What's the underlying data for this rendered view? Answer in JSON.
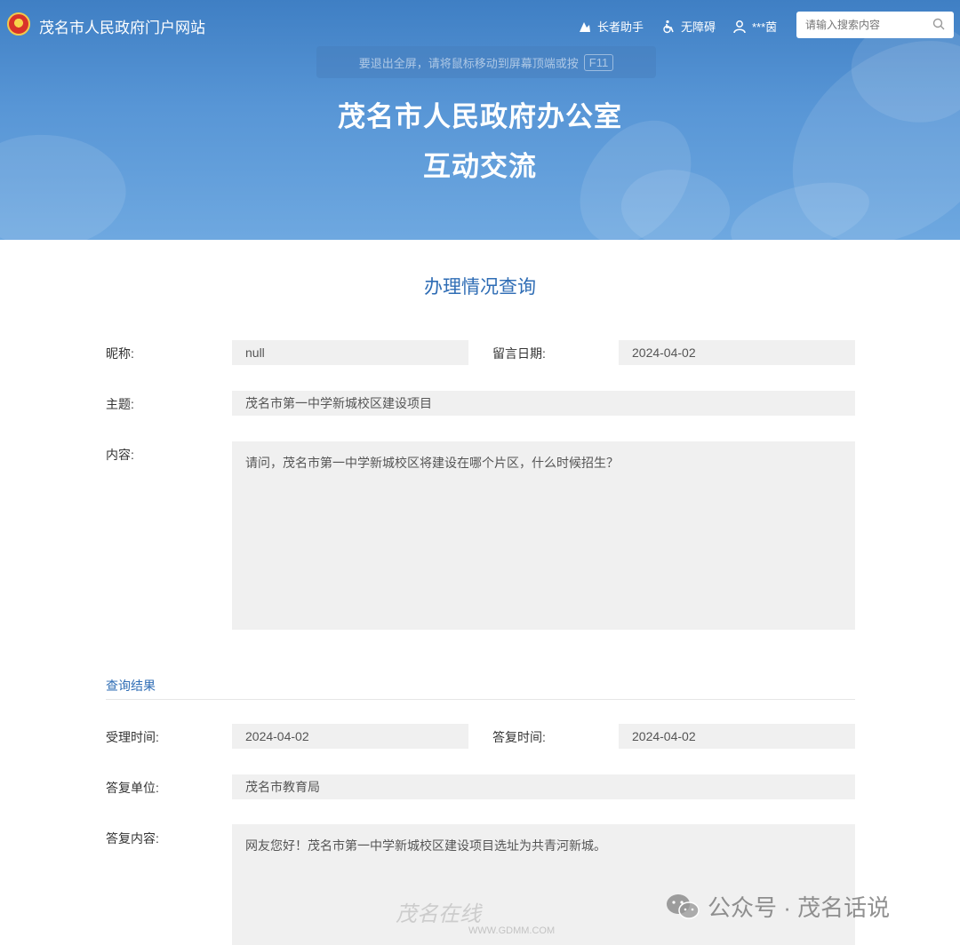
{
  "header": {
    "site_name": "茂名市人民政府门户网站",
    "tools": {
      "elder": "长者助手",
      "accessible": "无障碍",
      "user": "***茵"
    },
    "search_placeholder": "请输入搜索内容"
  },
  "fullscreen_hint": {
    "text": "要退出全屏，请将鼠标移动到屏幕顶端或按",
    "key": "F11"
  },
  "banner": {
    "title_line1": "茂名市人民政府办公室",
    "title_line2": "互动交流"
  },
  "page_title": "办理情况查询",
  "message": {
    "nickname_label": "昵称:",
    "nickname": "null",
    "date_label": "留言日期:",
    "date": "2024-04-02",
    "subject_label": "主题:",
    "subject": "茂名市第一中学新城校区建设项目",
    "content_label": "内容:",
    "content": "请问，茂名市第一中学新城校区将建设在哪个片区，什么时候招生？"
  },
  "result": {
    "section_title": "查询结果",
    "accept_time_label": "受理时间:",
    "accept_time": "2024-04-02",
    "reply_time_label": "答复时间:",
    "reply_time": "2024-04-02",
    "reply_unit_label": "答复单位:",
    "reply_unit": "茂名市教育局",
    "reply_content_label": "答复内容:",
    "reply_content": "网友您好！茂名市第一中学新城校区建设项目选址为共青河新城。"
  },
  "watermarks": {
    "wechat": "公众号 · 茂名话说",
    "gdmm_brand": "茂名在线",
    "gdmm_url": "WWW.GDMM.COM"
  },
  "colors": {
    "accent": "#2f6db5",
    "banner": "#4a8ad0",
    "field_bg": "#f0f0f0"
  }
}
